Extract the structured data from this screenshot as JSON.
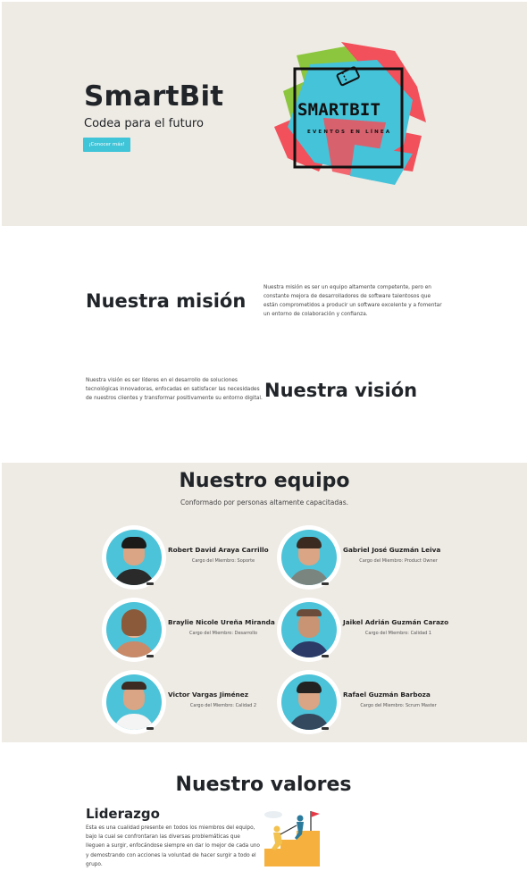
{
  "hero": {
    "title": "SmartBit",
    "subtitle": "Codea para el futuro",
    "button_label": "¡Conocer más!",
    "logo_text": "SMARTBIT",
    "logo_subtext": "EVENTOS EN LÍNEA"
  },
  "mission": {
    "title": "Nuestra misión",
    "text": "Nuestra misión es ser un equipo altamente competente, pero en constante mejora de desarrolladores de software talentosos que están comprometidos a producir un software excelente y a fomentar un entorno de colaboración y confianza."
  },
  "vision": {
    "title": "Nuestra visión",
    "text": "Nuestra visión es ser líderes en el desarrollo de soluciones tecnológicas innovadoras, enfocadas en satisfacer las necesidades de nuestros clientes y transformar positivamente su entorno digital."
  },
  "team": {
    "title": "Nuestro equipo",
    "subtitle": "Conformado por personas altamente capacitadas.",
    "members": [
      {
        "name": "Robert David Araya Carrillo",
        "role": "Cargo del Miembro: Soporte"
      },
      {
        "name": "Gabriel José Guzmán Leiva",
        "role": "Cargo del Miembro: Product Owner"
      },
      {
        "name": "Braylie Nicole Ureña Miranda",
        "role": "Cargo del Miembro: Desarrollo"
      },
      {
        "name": "Jaikel Adrián Guzmán Carazo",
        "role": "Cargo del Miembro: Calidad 1"
      },
      {
        "name": "Victor Vargas Jiménez",
        "role": "Cargo del Miembro: Calidad 2"
      },
      {
        "name": "Rafael Guzmán Barboza",
        "role": "Cargo del Miembro: Scrum Master"
      }
    ]
  },
  "values": {
    "title": "Nuestro valores",
    "items": [
      {
        "name": "Liderazgo",
        "text": "Esta es una cualidad presente en todos los miembros del equipo, bajo la cual se confrontaran las diversas problemáticas que lleguen a surgir, enfocándose siempre en dar lo mejor de cada uno y demostrando con acciones la voluntad de hacer surgir a todo el grupo."
      }
    ]
  },
  "colors": {
    "section_bg": "#eeeae4",
    "accent": "#3fc4d8",
    "text": "#212529"
  }
}
